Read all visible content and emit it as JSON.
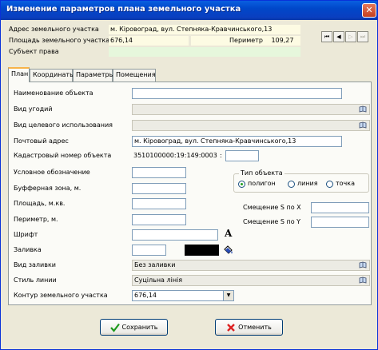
{
  "window": {
    "title": "Изменение параметров плана земельного участка",
    "close_glyph": "✕"
  },
  "header": {
    "address_label": "Адрес земельного участка",
    "address_value": "м. Кіровоград, вул. Степняка-Кравчинського,13",
    "area_label": "Площадь земельного участка",
    "area_value": "676,14",
    "perimeter_label": "Периметр",
    "perimeter_value": "109,27",
    "subject_label": "Субъект права",
    "subject_value": ""
  },
  "nav": {
    "first": "⏮",
    "prev": "◀",
    "next": "▷",
    "last": "⏭"
  },
  "tabs": [
    {
      "label": "План"
    },
    {
      "label": "Координаты"
    },
    {
      "label": "Параметры"
    },
    {
      "label": "Помещения"
    }
  ],
  "form": {
    "name_label": "Наименование объекта",
    "name_value": "",
    "land_type_label": "Вид угодий",
    "land_type_value": "",
    "purpose_label": "Вид целевого использования",
    "purpose_value": "",
    "postal_label": "Почтовый адрес",
    "postal_value": "м. Кіровоград, вул. Степняка-Кравчинського,13",
    "cadastral_label": "Кадастровый номер объекта",
    "cadastral_value": "3510100000:19:149:0003",
    "cadastral_sep": ":",
    "cadastral_extra": "",
    "symbol_label": "Условное обозначение",
    "buffer_label": "Буфферная зона, м.",
    "area_label": "Площадь, м.кв.",
    "perimeter_label": "Периметр, м.",
    "font_label": "Шрифт",
    "fill_label": "Заливка",
    "fill_color": "#000000",
    "fill_type_label": "Вид заливки",
    "fill_type_value": "Без заливки",
    "line_style_label": "Стиль линии",
    "line_style_value": "Суцільна лінія",
    "contour_label": "Контур земельного участка",
    "contour_value": "676,14",
    "object_type": {
      "title": "Тип объекта",
      "options": [
        "полигон",
        "линия",
        "точка"
      ],
      "selected": "полигон"
    },
    "offset_x_label": "Смещение S по X",
    "offset_y_label": "Смещение S по Y",
    "font_glyph": "A"
  },
  "footer": {
    "save_label": "Сохранить",
    "cancel_label": "Отменить"
  },
  "colors": {
    "titlebar": "#0a5fe0",
    "window_bg": "#ece9d8",
    "highlight": "#fdfbe3",
    "active_tab": "#f7b34a"
  }
}
